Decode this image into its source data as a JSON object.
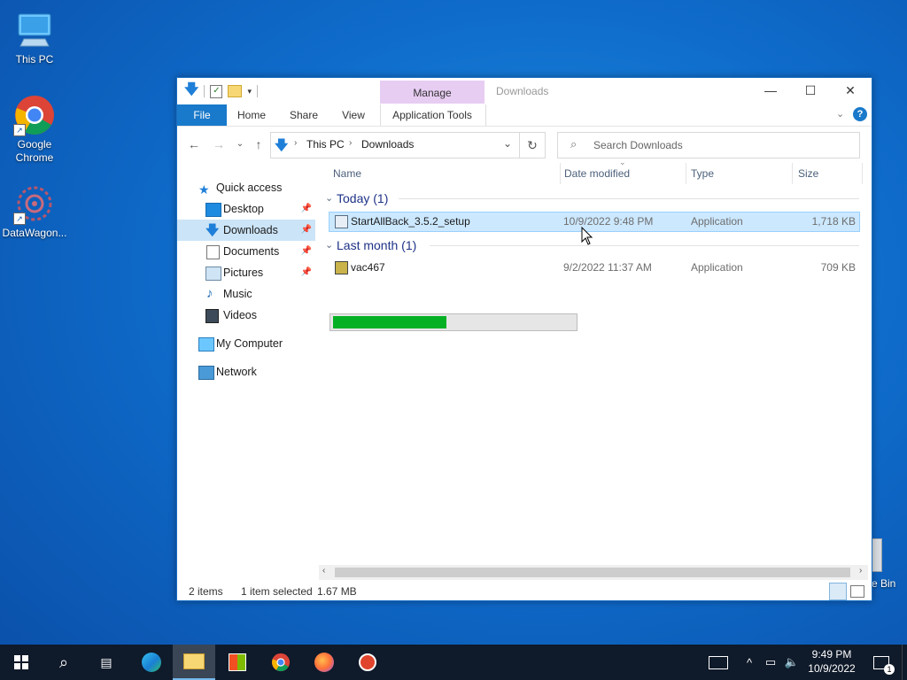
{
  "desktop": {
    "icons": [
      {
        "label": "This PC"
      },
      {
        "label": "Google Chrome"
      },
      {
        "label": "DataWagon..."
      }
    ],
    "recycle_bin_partial_label": "e Bin"
  },
  "window": {
    "title": "Downloads",
    "context_tab_label": "Manage",
    "ribbon_tabs": [
      "File",
      "Home",
      "Share",
      "View",
      "Application Tools"
    ],
    "address": {
      "crumbs": [
        "This PC",
        "Downloads"
      ]
    },
    "search_placeholder": "Search Downloads",
    "nav": {
      "quick_access": "Quick access",
      "items": [
        "Desktop",
        "Downloads",
        "Documents",
        "Pictures",
        "Music",
        "Videos"
      ],
      "my_computer": "My Computer",
      "network": "Network"
    },
    "columns": [
      "Name",
      "Date modified",
      "Type",
      "Size"
    ],
    "groups": [
      {
        "label": "Today (1)",
        "files": [
          {
            "name": "StartAllBack_3.5.2_setup",
            "date": "10/9/2022 9:48 PM",
            "type": "Application",
            "size": "1,718 KB",
            "selected": true
          }
        ]
      },
      {
        "label": "Last month (1)",
        "files": [
          {
            "name": "vac467",
            "date": "9/2/2022 11:37 AM",
            "type": "Application",
            "size": "709 KB",
            "selected": false
          }
        ]
      }
    ],
    "progress_fraction": 0.47,
    "status": {
      "items": "2 items",
      "selected": "1 item selected",
      "size": "1.67 MB"
    }
  },
  "taskbar": {
    "time": "9:49 PM",
    "date": "10/9/2022",
    "notification_count": "1"
  },
  "colors": {
    "accent": "#1979ca",
    "selection": "#cce8ff",
    "progress": "#06b025",
    "context_tab": "#e8cdf3"
  }
}
